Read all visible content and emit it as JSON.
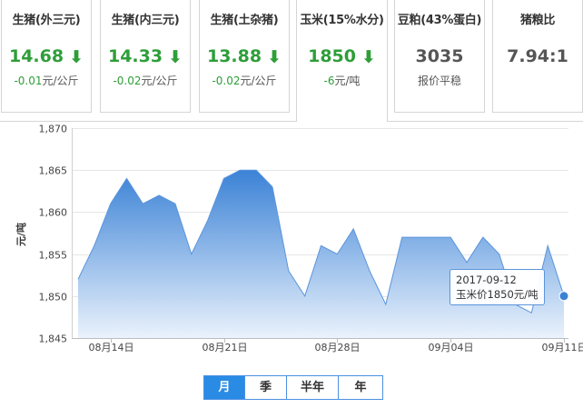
{
  "cards": [
    {
      "title": "生猪(外三元)",
      "price": "14.68",
      "trend": "down",
      "change_num": "-0.01",
      "change_unit": "元/公斤"
    },
    {
      "title": "生猪(内三元)",
      "price": "14.33",
      "trend": "down",
      "change_num": "-0.02",
      "change_unit": "元/公斤"
    },
    {
      "title": "生猪(土杂猪)",
      "price": "13.88",
      "trend": "down",
      "change_num": "-0.02",
      "change_unit": "元/公斤"
    },
    {
      "title": "玉米(15%水分)",
      "price": "1850",
      "trend": "down",
      "change_num": "-6",
      "change_unit": "元/吨",
      "active": true
    },
    {
      "title": "豆粕(43%蛋白)",
      "price": "3035",
      "trend": "flat",
      "change_text": "报价平稳"
    },
    {
      "title": "猪粮比",
      "price": "7.94:1",
      "trend": "flat",
      "change_text": ""
    }
  ],
  "colors": {
    "down": "#2e9e39",
    "accent": "#2a8be5",
    "area_top": "#3b82d6",
    "area_bottom": "#e8f1fb"
  },
  "tooltip": {
    "date": "2017-09-12",
    "label": "玉米价1850元/吨"
  },
  "range": {
    "options": [
      "月",
      "季",
      "半年",
      "年"
    ],
    "selected": "月"
  },
  "chart_data": {
    "type": "area",
    "ylabel": "元/吨",
    "ylim": [
      1845,
      1870
    ],
    "yticks": [
      1845,
      1850,
      1855,
      1860,
      1865,
      1870
    ],
    "ytick_labels": [
      "1,845",
      "1,850",
      "1,855",
      "1,860",
      "1,865",
      "1,870"
    ],
    "x_tick_labels": [
      "08月14日",
      "08月21日",
      "08月28日",
      "09月04日",
      "09月11日"
    ],
    "x_tick_index": [
      2,
      9,
      16,
      23,
      30
    ],
    "x_dates": [
      "08-12",
      "08-13",
      "08-14",
      "08-15",
      "08-16",
      "08-17",
      "08-18",
      "08-19",
      "08-20",
      "08-21",
      "08-22",
      "08-23",
      "08-24",
      "08-25",
      "08-26",
      "08-27",
      "08-28",
      "08-29",
      "08-30",
      "08-31",
      "09-01",
      "09-02",
      "09-03",
      "09-04",
      "09-05",
      "09-06",
      "09-07",
      "09-08",
      "09-09",
      "09-10",
      "09-11",
      "09-12"
    ],
    "values": [
      1852,
      1856,
      1861,
      1864,
      1861,
      1862,
      1861,
      1855,
      1859,
      1864,
      1865,
      1865,
      1863,
      1853,
      1850,
      1856,
      1855,
      1858,
      1853,
      1849,
      1857,
      1857,
      1857,
      1857,
      1854,
      1857,
      1855,
      1849,
      1848,
      1856,
      1850
    ],
    "grid": true,
    "legend": "none"
  }
}
